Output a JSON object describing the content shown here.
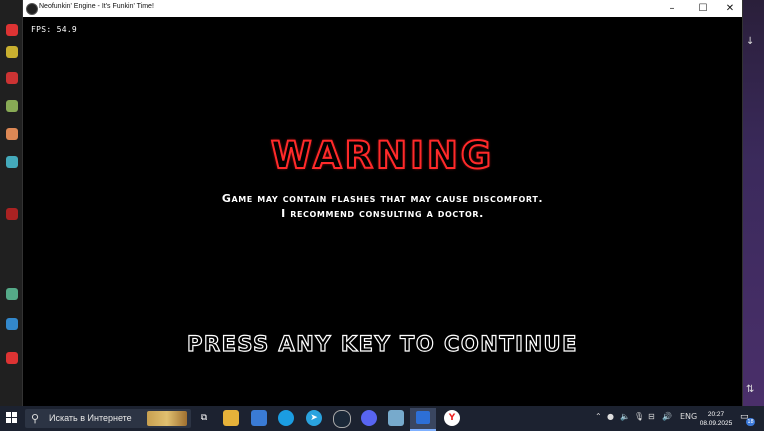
{
  "window": {
    "title": "Neofunkin' Engine - It's Funkin' Time!",
    "minimize_icon": "minimize-icon",
    "maximize_icon": "maximize-icon",
    "close_icon": "close-icon"
  },
  "game": {
    "fps_text": "FPS: 54.9",
    "warning_title": "WARNING",
    "message_line1": "Game may contain flashes that may cause discomfort.",
    "message_line2": "I recommend consulting a doctor.",
    "press_prompt": "PRESS ANY KEY TO CONTINUE",
    "warning_color": "#ff2a2a"
  },
  "taskbar": {
    "search_placeholder": "Искать в Интернете",
    "language": "ENG",
    "time": "20:27",
    "date": "08.09.2025",
    "notification_count": "18",
    "pinned_apps": [
      {
        "name": "task-view-icon"
      },
      {
        "name": "file-explorer-icon"
      },
      {
        "name": "store-icon"
      },
      {
        "name": "edge-icon"
      },
      {
        "name": "telegram-icon"
      },
      {
        "name": "steam-icon"
      },
      {
        "name": "discord-icon"
      },
      {
        "name": "paint-icon"
      },
      {
        "name": "active-app-icon"
      },
      {
        "name": "yandex-browser-icon"
      }
    ]
  }
}
